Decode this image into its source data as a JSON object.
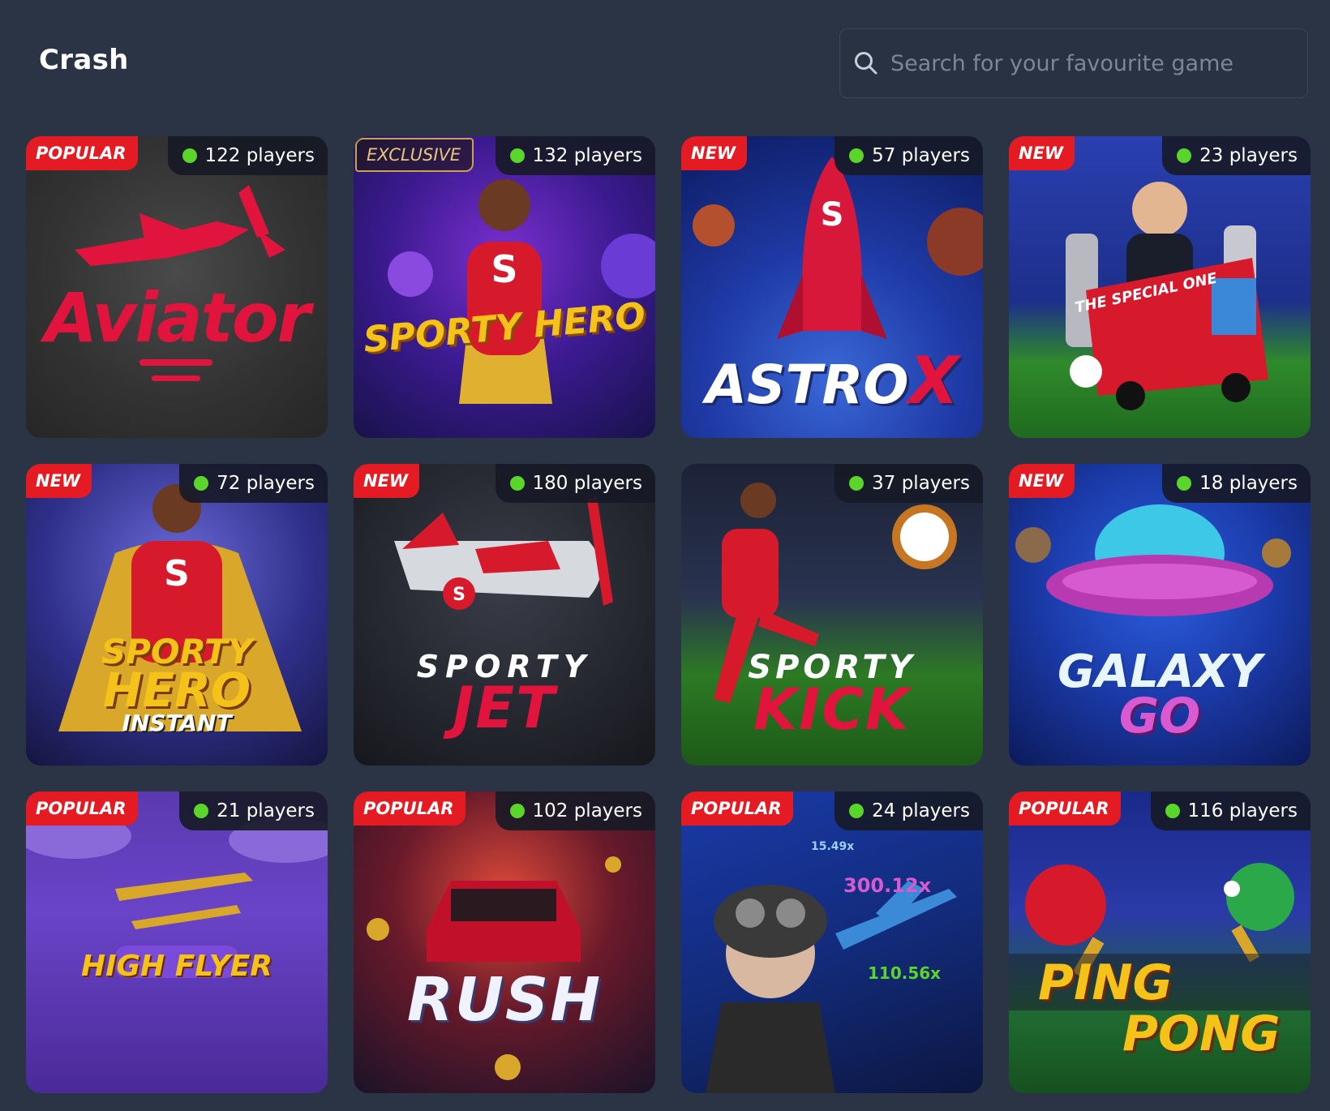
{
  "page": {
    "title": "Crash"
  },
  "search": {
    "placeholder": "Search for your favourite game",
    "icon": "search-icon"
  },
  "games": [
    {
      "tag": "POPULAR",
      "players": "122 players",
      "logo": [
        "Aviator"
      ]
    },
    {
      "tag": "EXCLUSIVE",
      "players": "132 players",
      "logo": [
        "SPORTY HERO"
      ]
    },
    {
      "tag": "NEW",
      "players": "57 players",
      "logo": [
        "ASTRO",
        "X"
      ]
    },
    {
      "tag": "NEW",
      "players": "23 players",
      "logo": [
        "THE SPECIAL ONE"
      ]
    },
    {
      "tag": "NEW",
      "players": "72 players",
      "logo": [
        "SPORTY",
        "HERO",
        "INSTANT"
      ]
    },
    {
      "tag": "NEW",
      "players": "180 players",
      "logo": [
        "SPORTY",
        "JET"
      ]
    },
    {
      "tag": "",
      "players": "37 players",
      "logo": [
        "SPORTY",
        "KICK"
      ]
    },
    {
      "tag": "NEW",
      "players": "18 players",
      "logo": [
        "GALAXY",
        "GO"
      ]
    },
    {
      "tag": "POPULAR",
      "players": "21 players",
      "logo": [
        "HIGH FLYER"
      ]
    },
    {
      "tag": "POPULAR",
      "players": "102 players",
      "logo": [
        "RUSH"
      ]
    },
    {
      "tag": "POPULAR",
      "players": "24 players",
      "logo": [
        "15.49x",
        "300.12x",
        "110.56x"
      ]
    },
    {
      "tag": "POPULAR",
      "players": "116 players",
      "logo": [
        "PING",
        "PONG"
      ]
    }
  ],
  "colors": {
    "background": "#2b3445",
    "tag": "#e41b23",
    "online_dot": "#5ad62a"
  }
}
